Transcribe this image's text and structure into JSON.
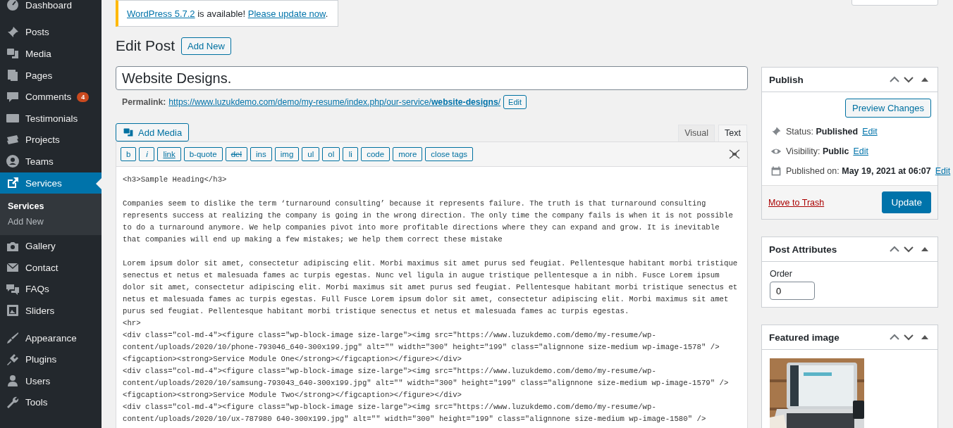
{
  "sidebar": {
    "groups": [
      [
        {
          "label": "Dashboard",
          "selected": false
        }
      ],
      [
        {
          "label": "Posts",
          "selected": false
        },
        {
          "label": "Media",
          "selected": false
        },
        {
          "label": "Pages",
          "selected": false
        },
        {
          "label": "Comments",
          "badge": "4",
          "selected": false
        },
        {
          "label": "Testimonials",
          "selected": false
        },
        {
          "label": "Projects",
          "selected": false
        },
        {
          "label": "Teams",
          "selected": false
        },
        {
          "label": "Services",
          "selected": true,
          "submenu": [
            {
              "label": "Services",
              "selected": true
            },
            {
              "label": "Add New",
              "selected": false
            }
          ]
        },
        {
          "label": "Gallery",
          "selected": false
        },
        {
          "label": "Contact",
          "selected": false
        },
        {
          "label": "FAQs",
          "selected": false
        },
        {
          "label": "Sliders",
          "selected": false
        }
      ],
      [
        {
          "label": "Appearance",
          "selected": false
        },
        {
          "label": "Plugins",
          "selected": false
        },
        {
          "label": "Users",
          "selected": false
        },
        {
          "label": "Tools",
          "selected": false
        }
      ]
    ]
  },
  "notice": {
    "version_link": "WordPress 5.7.2",
    "text": " is available! ",
    "update_link": "Please update now",
    "end": "."
  },
  "heading": {
    "title": "Edit Post",
    "add_new": "Add New"
  },
  "title_field": {
    "value": "Website Designs."
  },
  "permalink": {
    "label": "Permalink:",
    "url": "https://www.luzukdemo.com/demo/my-resume/index.php/our-service/**website-designs**/",
    "edit": "Edit"
  },
  "add_media": "Add Media",
  "editor_tabs": [
    {
      "label": "Visual",
      "selected": false
    },
    {
      "label": "Text",
      "selected": true
    }
  ],
  "quicktags": [
    {
      "label": "b",
      "kind": "plain"
    },
    {
      "label": "i",
      "kind": "italic"
    },
    {
      "label": "link",
      "kind": "underline"
    },
    {
      "label": "b-quote",
      "kind": "plain"
    },
    {
      "label": "del",
      "kind": "strike"
    },
    {
      "label": "ins",
      "kind": "plain"
    },
    {
      "label": "img",
      "kind": "plain"
    },
    {
      "label": "ul",
      "kind": "plain"
    },
    {
      "label": "ol",
      "kind": "plain"
    },
    {
      "label": "li",
      "kind": "plain"
    },
    {
      "label": "code",
      "kind": "plain"
    },
    {
      "label": "more",
      "kind": "plain"
    },
    {
      "label": "close tags",
      "kind": "plain"
    }
  ],
  "editor_paragraphs": [
    [
      "<h3>Sample Heading</h3>"
    ],
    [
      "Companies seem to dislike the term ‘turnaround consulting’ because it represents failure. The truth is that turnaround consulting",
      "represents success at realizing the company is going in the wrong direction. The only time the company fails is when it is not possible",
      "to do a turnaround anymore. We help companies pivot into more profitable directions where they can expand and grow. It is inevitable",
      "that companies will end up making a few mistakes; we help them correct these mistake"
    ],
    [
      "Lorem ipsum dolor sit amet, consectetur adipiscing elit. Morbi maximus sit amet purus sed feugiat. Pellentesque habitant morbi tristique",
      "senectus et netus et malesuada fames ac turpis egestas. Nunc vel ligula in augue tristique pellentesque a in nibh. Fusce Lorem ipsum",
      "dolor sit amet, consectetur adipiscing elit. Morbi maximus sit amet purus sed feugiat. Pellentesque habitant morbi tristique senectus et",
      "netus et malesuada fames ac turpis egestas. Full Fusce Lorem ipsum dolor sit amet, consectetur adipiscing elit. Morbi maximus sit amet",
      "purus sed feugiat. Pellentesque habitant morbi tristique senectus et netus et malesuada fames ac turpis egestas.",
      "<hr>",
      "<div class=\"col-md-4\"><figure class=\"wp-block-image size-large\"><img src=\"https://www.luzukdemo.com/demo/my-resume/wp-",
      "content/uploads/2020/10/phone-793046_640-300x199.jpg\" alt=\"\" width=\"300\" height=\"199\" class=\"alignnone size-medium wp-image-1578\" />",
      "<figcaption><strong>Service Module One</strong></figcaption></figure></div>",
      "<div class=\"col-md-4\"><figure class=\"wp-block-image size-large\"><img src=\"https://www.luzukdemo.com/demo/my-resume/wp-",
      "content/uploads/2020/10/samsung-793043_640-300x199.jpg\" alt=\"\" width=\"300\" height=\"199\" class=\"alignnone size-medium wp-image-1579\" />",
      "<figcaption><strong>Service Module Two</strong></figcaption></figure></div>",
      "<div class=\"col-md-4\"><figure class=\"wp-block-image size-large\"><img src=\"https://www.luzukdemo.com/demo/my-resume/wp-",
      "content/uploads/2020/10/ux-787980 640-300x199.jpg\" alt=\"\" width=\"300\" height=\"199\" class=\"alignnone size-medium wp-image-1580\" />"
    ]
  ],
  "publish": {
    "title": "Publish",
    "preview": "Preview Changes",
    "rows": [
      {
        "label": "Status:",
        "value": "Published",
        "link": "Edit"
      },
      {
        "label": "Visibility:",
        "value": "Public",
        "link": "Edit"
      },
      {
        "label": "Published on:",
        "value": "May 19, 2021 at 06:07",
        "link": "Edit"
      }
    ],
    "trash": "Move to Trash",
    "update": "Update"
  },
  "attributes": {
    "title": "Post Attributes",
    "order_label": "Order",
    "order_value": "0"
  },
  "featured": {
    "title": "Featured image"
  }
}
